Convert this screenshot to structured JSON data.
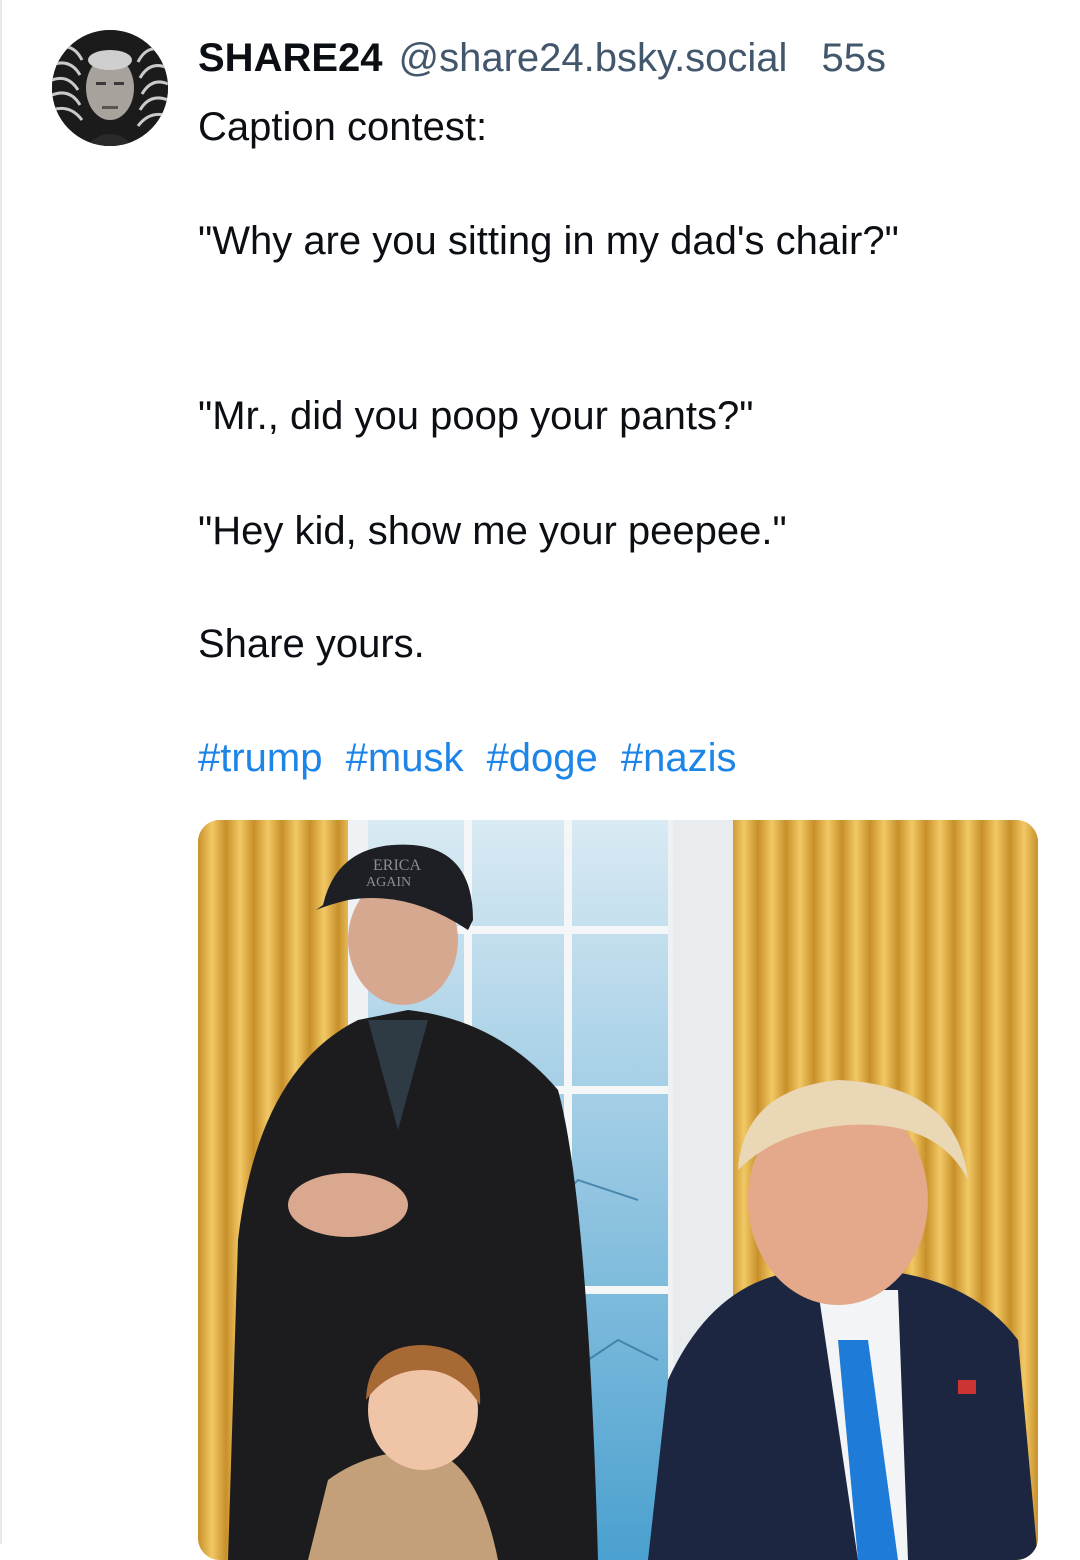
{
  "post": {
    "author": {
      "display_name": "SHARE24",
      "handle": "@share24.bsky.social"
    },
    "timestamp": "55s",
    "paragraphs": [
      "Caption contest:",
      "\"Why are you sitting in my dad's chair?\"",
      "\"Mr., did you poop your pants?\"",
      "\"Hey kid, show me your peepee.\"",
      "Share yours."
    ],
    "hashtags": [
      "#trump",
      "#musk",
      "#doge",
      "#nazis"
    ],
    "image": {
      "cap_text_line1": "ERICA",
      "cap_text_line2": "AGAIN"
    }
  },
  "colors": {
    "text": "#0b0f14",
    "muted": "#42576c",
    "link": "#1d84e8",
    "background": "#ffffff"
  }
}
